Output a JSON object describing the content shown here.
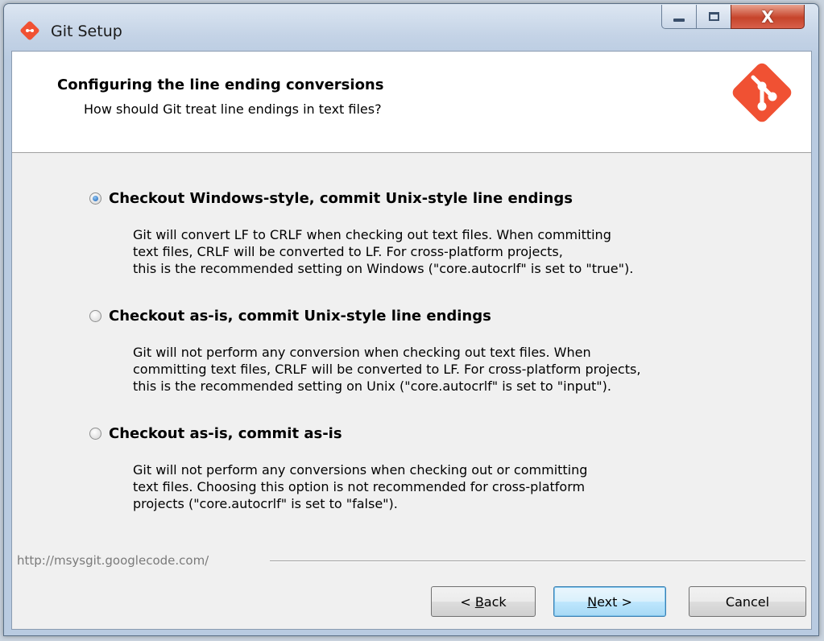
{
  "window": {
    "title": "Git Setup",
    "controls": {
      "minimize": "minimize",
      "maximize": "maximize",
      "close": "X"
    }
  },
  "header": {
    "title": "Configuring the line ending conversions",
    "subtitle": "How should Git treat line endings in text files?"
  },
  "options": [
    {
      "label": "Checkout Windows-style, commit Unix-style line endings",
      "checked": true,
      "description": [
        "Git will convert LF to CRLF when checking out text files. When committing",
        "text files, CRLF will be converted to LF. For cross-platform projects,",
        "this is the recommended setting on Windows (\"core.autocrlf\" is set to \"true\")."
      ]
    },
    {
      "label": "Checkout as-is, commit Unix-style line endings",
      "checked": false,
      "description": [
        "Git will not perform any conversion when checking out text files. When",
        "committing text files, CRLF will be converted to LF. For cross-platform projects,",
        "this is the recommended setting on Unix (\"core.autocrlf\" is set to \"input\")."
      ]
    },
    {
      "label": "Checkout as-is, commit as-is",
      "checked": false,
      "description": [
        "Git will not perform any conversions when checking out or committing",
        "text files. Choosing this option is not recommended for cross-platform",
        "projects (\"core.autocrlf\" is set to \"false\")."
      ]
    }
  ],
  "footer": {
    "url": "http://msysgit.googlecode.com/",
    "buttons": {
      "back": {
        "pre": "< ",
        "accel": "B",
        "post": "ack"
      },
      "next": {
        "pre": "",
        "accel": "N",
        "post": "ext >"
      },
      "cancel": "Cancel"
    }
  },
  "colors": {
    "git_logo": "#f05133",
    "selected_radio": "#1b63b5"
  },
  "icons": [
    "git-diamond-icon",
    "git-logo-icon",
    "minimize-icon",
    "maximize-icon",
    "close-icon"
  ]
}
